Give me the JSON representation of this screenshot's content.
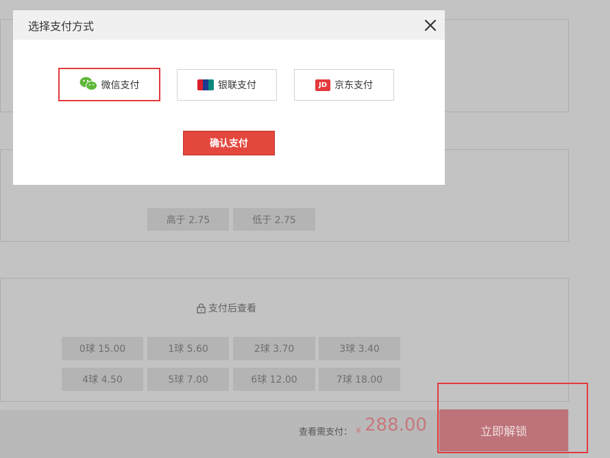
{
  "background": {
    "odds_row_1": [
      "高于 2.75",
      "低于 2.75"
    ],
    "lock_text": "支付后查看",
    "goals_odds": [
      [
        "0球 15.00",
        "1球 5.60",
        "2球 3.70",
        "3球 3.40"
      ],
      [
        "4球 4.50",
        "5球 7.00",
        "6球 12.00",
        "7球 18.00"
      ]
    ]
  },
  "bottom": {
    "pay_label": "查看需支付：",
    "currency": "¥",
    "amount": "288.00",
    "unlock_label": "立即解锁"
  },
  "modal": {
    "title": "选择支付方式",
    "methods": [
      {
        "label": "微信支付",
        "icon": "wechat-icon",
        "selected": true
      },
      {
        "label": "银联支付",
        "icon": "unionpay-icon",
        "selected": false
      },
      {
        "label": "京东支付",
        "icon": "jd-icon",
        "selected": false
      }
    ],
    "jd_icon_text": "JD",
    "confirm_label": "确认支付"
  },
  "colors": {
    "accent": "#e4393c",
    "overlay": "#c3c3c3",
    "wechat_green": "#5fb83a",
    "unlock_dimmed": "#bd7379"
  }
}
